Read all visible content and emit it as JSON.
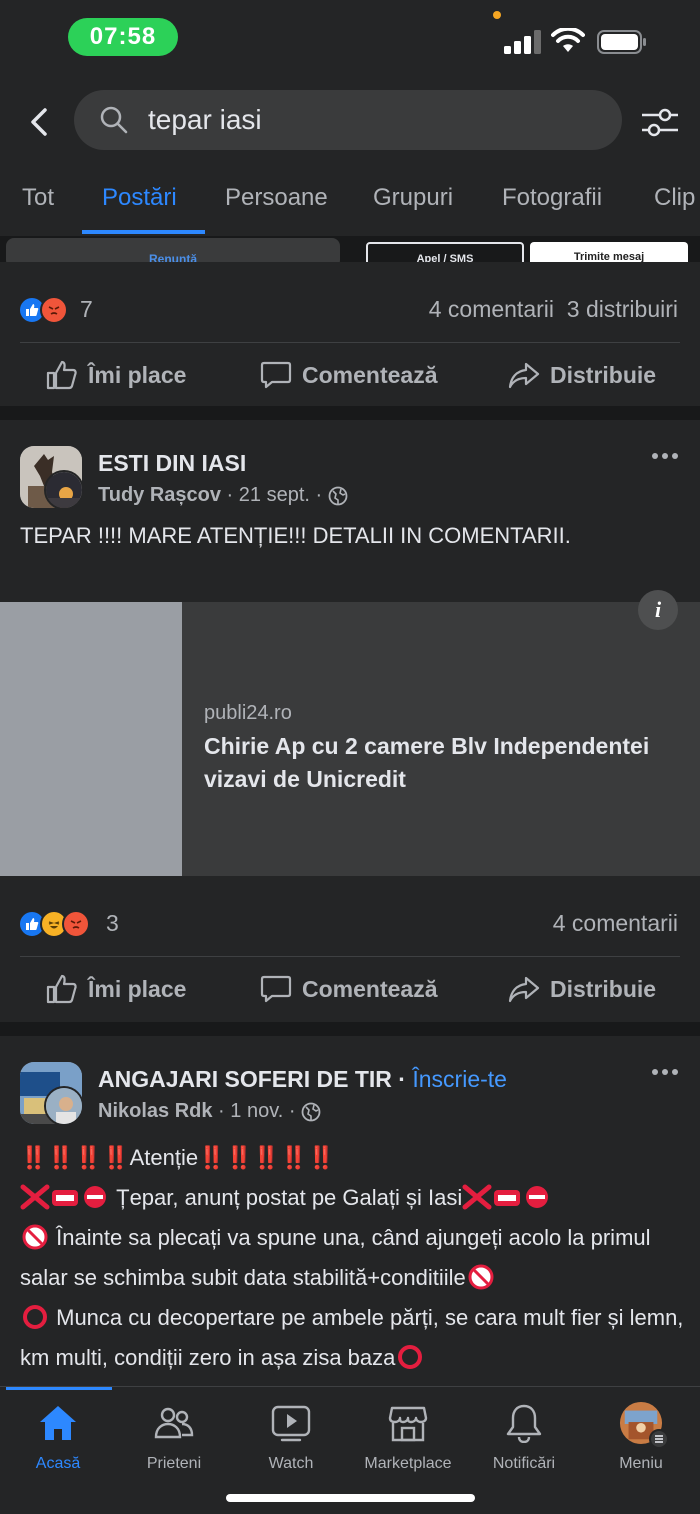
{
  "status": {
    "time": "07:58"
  },
  "search": {
    "query": "tepar iasi"
  },
  "tabs": [
    {
      "label": "Tot"
    },
    {
      "label": "Postări"
    },
    {
      "label": "Persoane"
    },
    {
      "label": "Grupuri"
    },
    {
      "label": "Fotografii"
    },
    {
      "label": "Clip"
    }
  ],
  "peek": {
    "btn1": "Renunță",
    "btn2": "Apel / SMS",
    "btn3": "Trimite mesaj"
  },
  "post1": {
    "reaction_count": "7",
    "comments": "4 comentarii",
    "shares": "3 distribuiri"
  },
  "actions": {
    "like": "Îmi place",
    "comment": "Comentează",
    "share": "Distribuie"
  },
  "post2": {
    "group": "ESTI DIN IASI",
    "author": "Tudy Rașcov",
    "date": "21 sept.",
    "text": "TEPAR !!!! MARE ATENȚIE!!! DETALII IN COMENTARII.",
    "link_domain": "publi24.ro",
    "link_title": "Chirie Ap cu 2 camere Blv Independentei vizavi de Unicredit",
    "reaction_count": "3",
    "comments": "4 comentarii"
  },
  "post3": {
    "group": "ANGAJARI SOFERI DE TIR",
    "separator": " · ",
    "join": "Înscrie-te",
    "author": "Nikolas Rdk",
    "date": "1 nov.",
    "line1_marks_left": "‼️‼️‼️‼️",
    "line1_word": "Atenție",
    "line1_marks_right": "‼️‼️‼️‼️‼️",
    "line2": "Țepar, anunț postat pe Galați și Iasi",
    "line3": "Înainte sa plecați va spune una, când ajungeți acolo la primul salar se schimba subit data stabilită+conditiile",
    "line4": "Munca cu decopertare pe ambele părți, se cara mult fier și lemn, km multi, condiții zero in așa zisa baza"
  },
  "nav": [
    {
      "label": "Acasă",
      "icon": "home-icon"
    },
    {
      "label": "Prieteni",
      "icon": "friends-icon"
    },
    {
      "label": "Watch",
      "icon": "watch-icon"
    },
    {
      "label": "Marketplace",
      "icon": "marketplace-icon"
    },
    {
      "label": "Notificări",
      "icon": "bell-icon"
    },
    {
      "label": "Meniu",
      "icon": "menu-avatar-icon"
    }
  ],
  "colors": {
    "accent": "#2d88ff",
    "background": "#18191a",
    "card": "#242526",
    "status_pill": "#2cd158"
  }
}
